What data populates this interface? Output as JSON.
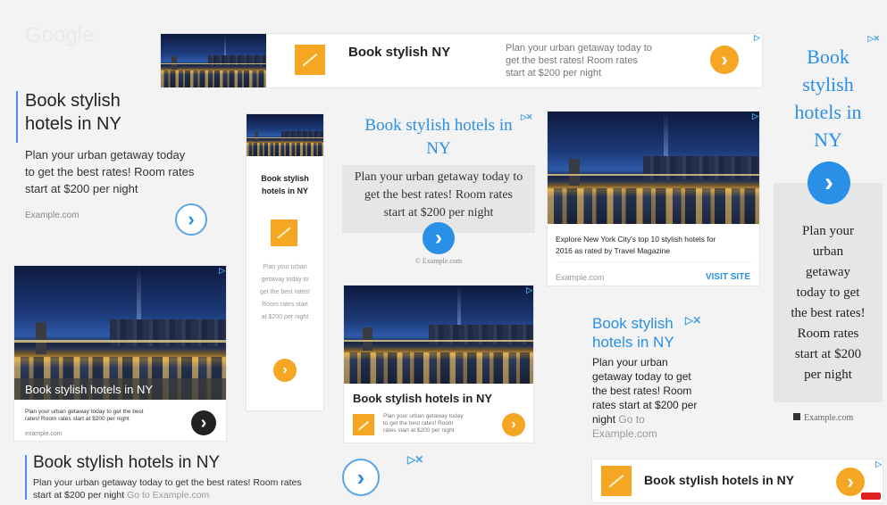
{
  "brand_watermark": "Google",
  "ad": {
    "headline": "Book stylish hotels in NY",
    "headline_l1": "Book stylish",
    "headline_l2": "hotels in NY",
    "body": "Plan your urban getaway today to get the best rates! Room rates start at $200 per night",
    "body_lines_a": [
      "Plan your urban getaway today",
      "to get the best rates! Room rates",
      "start at $200 per night"
    ],
    "body_lines_b": [
      "Plan your urban getaway today to",
      "get the best rates! Room rates",
      "start at $200 per night"
    ],
    "body_lines_c": [
      "Plan your urban getaway today",
      "to get the best rates! Room",
      "rates start at $200 per night"
    ],
    "narrow_body": [
      "Plan your urban",
      "getaway today to",
      "get the best rates!",
      "Room rates start",
      "at $200 per night"
    ],
    "tall_body": [
      "Plan your",
      "urban",
      "getaway",
      "today to get",
      "the best rates!",
      "Room rates",
      "start at $200",
      "per night"
    ],
    "text_ad_body": [
      "Plan your urban",
      "getaway today to get",
      "the best rates! Room",
      "rates start at $200 per",
      "night"
    ],
    "go_to": "Go to",
    "domain": "Example.com",
    "domain_lower": "example.com",
    "domain_dot": "Example.com",
    "banner_body_line1": "Plan your urban getaway today to get the best rates! Room rates",
    "banner_body_line2": "start at $200 per night",
    "small_body_l1": "Plan your urban getaway today to get the best",
    "small_body_l2": "rates! Room rates start at $200 per night",
    "visit_site": "VISIT SITE",
    "explore_l1": "Explore New York City's top 10 stylish hotels for",
    "explore_l2": "2016 as rated by Travel Magazine",
    "tall_headline": [
      "Book",
      "stylish",
      "hotels in",
      "NY"
    ],
    "narrow_headline": [
      "Book stylish",
      "hotels in NY"
    ],
    "center_headline_l1": "Book stylish hotels in",
    "center_headline_l2": "NY",
    "arrow": "›",
    "adchoices": "▷✕"
  },
  "colors": {
    "orange": "#f5a623",
    "blue": "#2a8fe6",
    "accent_bar": "#4a90e2"
  }
}
